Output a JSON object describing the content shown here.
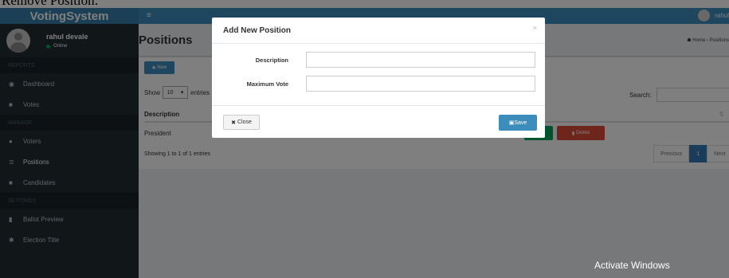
{
  "caption": "Remove Position:",
  "brand": "VotingSystem",
  "sidebar": {
    "user_name": "rahul devale",
    "user_status": "Online",
    "headers": [
      "REPORTS",
      "MANAGE",
      "SETTINGS"
    ],
    "items": [
      {
        "label": "Dashboard",
        "icon": "dashboard-icon"
      },
      {
        "label": "Votes",
        "icon": "lock-icon"
      },
      {
        "label": "Voters",
        "icon": "users-icon"
      },
      {
        "label": "Positions",
        "icon": "tasks-icon"
      },
      {
        "label": "Candidates",
        "icon": "black-tie-icon"
      },
      {
        "label": "Ballot Preview",
        "icon": "file-icon"
      },
      {
        "label": "Election Title",
        "icon": "cog-icon"
      }
    ]
  },
  "topbar": {
    "user": "rahul"
  },
  "page": {
    "title": "Positions",
    "breadcrumb_home": "Home",
    "breadcrumb_current": "Positions",
    "new_button": "New",
    "show_label": "Show",
    "entries_value": "10",
    "entries_label": "entries",
    "search_label": "Search:",
    "column": "Description",
    "rows": [
      {
        "description": "President"
      }
    ],
    "delete_label": "Delete",
    "showing": "Showing 1 to 1 of 1 entries",
    "pager": {
      "previous": "Previous",
      "page": "1",
      "next": "Next"
    }
  },
  "modal": {
    "title": "Add New Position",
    "close_x": "×",
    "fields": {
      "description_label": "Description",
      "max_vote_label": "Maximum Vote"
    },
    "close_button": "Close",
    "save_button": "Save"
  },
  "watermark": "Activate Windows",
  "colors": {
    "brand": "#367fa9",
    "topbar": "#3c8dbc",
    "sidebar": "#222d32",
    "danger": "#dd4b39",
    "success": "#00a65a"
  }
}
